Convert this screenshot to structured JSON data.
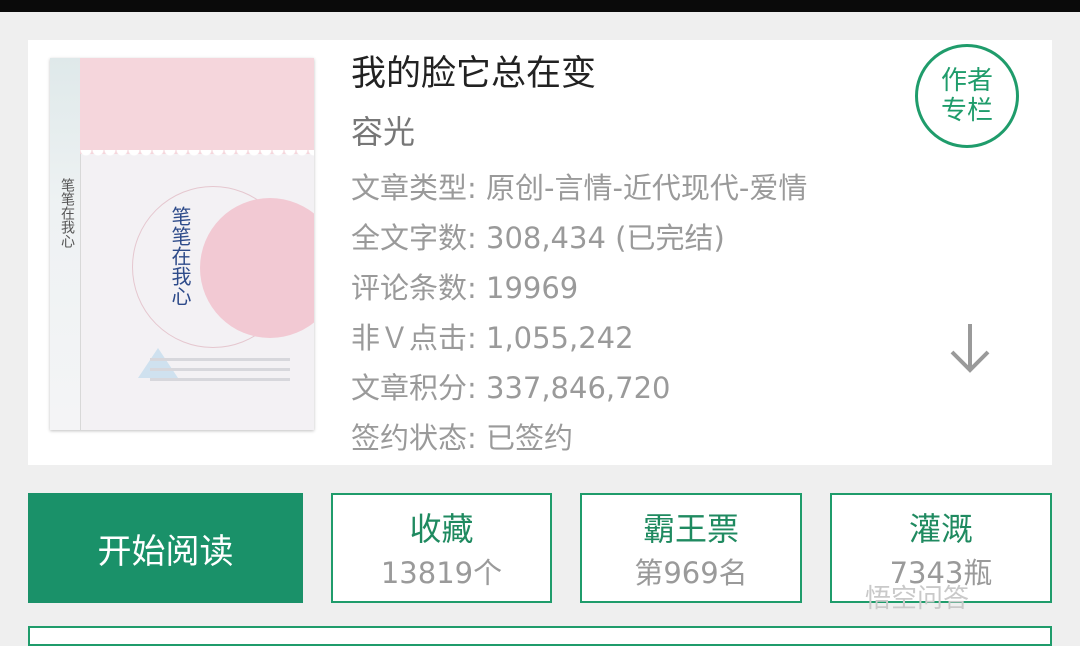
{
  "book": {
    "title": "我的脸它总在变",
    "author": "容光",
    "cover_title": "笔笔在我心",
    "info": [
      "文章类型: 原创-言情-近代现代-爱情",
      "全文字数: 308,434 (已完结)",
      "评论条数: 19969",
      "非Ｖ点击: 1,055,242",
      "文章积分: 337,846,720",
      "签约状态: 已签约"
    ]
  },
  "badge": {
    "line1": "作者",
    "line2": "专栏"
  },
  "actions": {
    "read": "开始阅读",
    "collect": {
      "label": "收藏",
      "value": "13819个"
    },
    "ticket": {
      "label": "霸王票",
      "value": "第969名"
    },
    "irrigate": {
      "label": "灌溉",
      "value": "7343瓶"
    }
  },
  "icons": {
    "expand": "arrow-down-icon"
  },
  "watermark": "悟空问答",
  "colors": {
    "accent": "#1a9169",
    "border": "#1f9c6b",
    "muted": "#9a9a9a"
  }
}
